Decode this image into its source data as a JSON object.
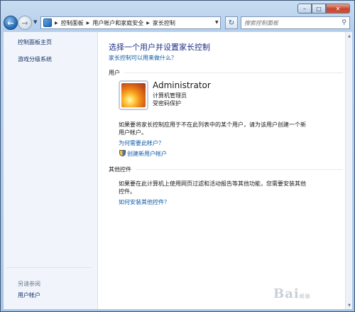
{
  "caption": {
    "minimize": "–",
    "maximize": "□",
    "close": "✕"
  },
  "nav": {
    "back_glyph": "←",
    "forward_glyph": "→",
    "breadcrumb": [
      "控制面板",
      "用户帐户和家庭安全",
      "家长控制"
    ],
    "refresh_glyph": "↻",
    "search_placeholder": "搜索控制面板"
  },
  "sidebar": {
    "links": [
      "控制面板主页",
      "游戏分级系统"
    ],
    "see_also_heading": "另请参阅",
    "see_also_links": [
      "用户帐户"
    ]
  },
  "main": {
    "title": "选择一个用户并设置家长控制",
    "help_link": "家长控制可以用来做什么？",
    "users_section": "用户",
    "user": {
      "name": "Administrator",
      "role": "计算机管理员",
      "status": "受密码保护"
    },
    "info_text": "如果要将家长控制应用于不在此列表中的某个用户，请为该用户创建一个新用户帐户。",
    "why_link": "为何需要此帐户？",
    "create_link": "创建新用户帐户",
    "other_section": "其他控件",
    "other_text": "如果要在此计算机上使用网页过滤和活动报告等其他功能，您需要安装其他控件。",
    "install_link": "如何安装其他控件？"
  },
  "watermark": {
    "brand": "Bai",
    "sub": "经验"
  },
  "colors": {
    "link": "#0c5ba8",
    "title": "#1e3287",
    "frame": "#b6d0ec"
  }
}
